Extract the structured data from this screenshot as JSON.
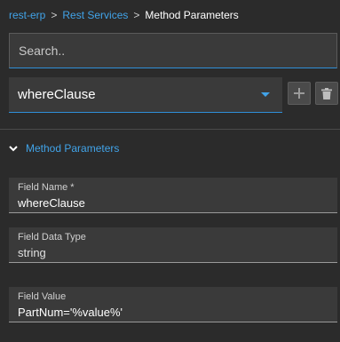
{
  "breadcrumb": {
    "items": [
      "rest-erp",
      "Rest Services"
    ],
    "separator": ">",
    "current": "Method Parameters"
  },
  "search": {
    "placeholder": "Search.."
  },
  "selector": {
    "value": "whereClause"
  },
  "section": {
    "title": "Method Parameters",
    "expanded": true
  },
  "fields": {
    "field_name": {
      "label": "Field Name *",
      "value": "whereClause"
    },
    "field_data_type": {
      "label": "Field Data Type",
      "value": "string"
    },
    "field_value": {
      "label": "Field Value",
      "value": "PartNum='%value%'"
    }
  },
  "colors": {
    "accent": "#41a3e8",
    "background": "#2b2b2b",
    "field_background": "#3a3a3a"
  },
  "icons": [
    "chevron-down-icon",
    "plus-icon",
    "trash-icon",
    "caret-down-icon"
  ]
}
